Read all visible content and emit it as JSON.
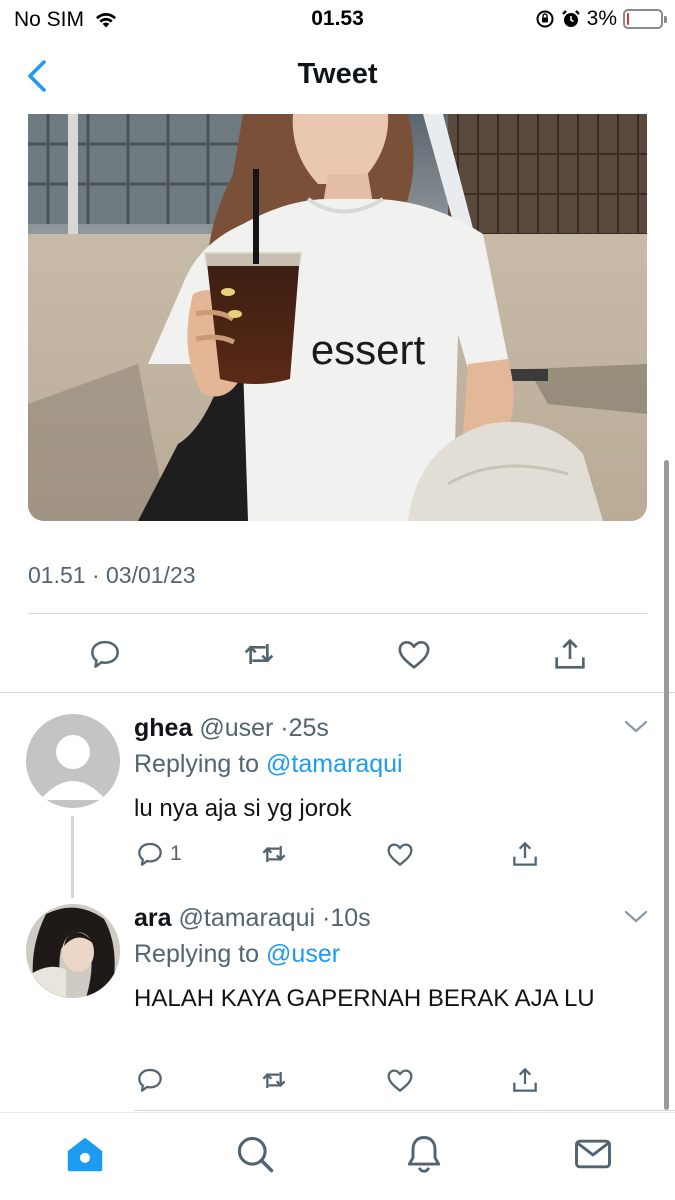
{
  "status_bar": {
    "carrier": "No SIM",
    "time": "01.53",
    "battery": "3%",
    "battery_level": 0.03,
    "battery_color": "#e0332f"
  },
  "header": {
    "title": "Tweet",
    "back_icon": "chevron-left-icon"
  },
  "tweet": {
    "image_text": "essert",
    "timestamp": "01.51 · 03/01/23"
  },
  "replies": [
    {
      "name": "ghea",
      "handle": "@user",
      "separator": "·",
      "time": "25s",
      "replying_prefix": "Replying to",
      "replying_to": "@tamaraqui",
      "text": "lu nya aja si yg jorok",
      "reply_count": "1"
    },
    {
      "name": "ara",
      "handle": "@tamaraqui",
      "separator": "·",
      "time": "10s",
      "replying_prefix": "Replying to",
      "replying_to": "@user",
      "text": "HALAH KAYA GAPERNAH BERAK AJA LU",
      "reply_count": ""
    }
  ],
  "tab_bar": {
    "items": [
      "home-icon",
      "search-icon",
      "notifications-icon",
      "messages-icon"
    ],
    "active": "home-icon"
  },
  "colors": {
    "accent": "#1d9bf0",
    "muted": "#536471",
    "divider": "#cfd9de"
  }
}
